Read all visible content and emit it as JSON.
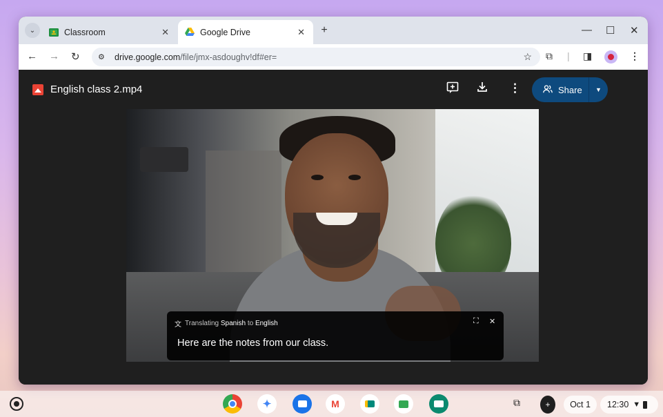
{
  "browser": {
    "tabs": [
      {
        "title": "Classroom",
        "icon": "classroom-icon",
        "active": false
      },
      {
        "title": "Google Drive",
        "icon": "google-drive-icon",
        "active": true
      }
    ],
    "url_host": "drive.google.com",
    "url_path": "/file/jmx-asdoughv!df#er="
  },
  "viewer": {
    "file_title": "English class 2.mp4",
    "share_label": "Share",
    "colors": {
      "share": "#0e4a7e",
      "background": "#1f1f1f"
    }
  },
  "caption": {
    "prefix": "Translating",
    "source_language": "Spanish",
    "connector": "to",
    "target_language": "English",
    "text": "Here are the notes from our class."
  },
  "shelf": {
    "apps": [
      "chrome-icon",
      "gemini-icon",
      "files-icon",
      "gmail-icon",
      "meet-icon",
      "classroom-icon",
      "slides-icon"
    ],
    "date": "Oct 1",
    "time": "12:30"
  }
}
